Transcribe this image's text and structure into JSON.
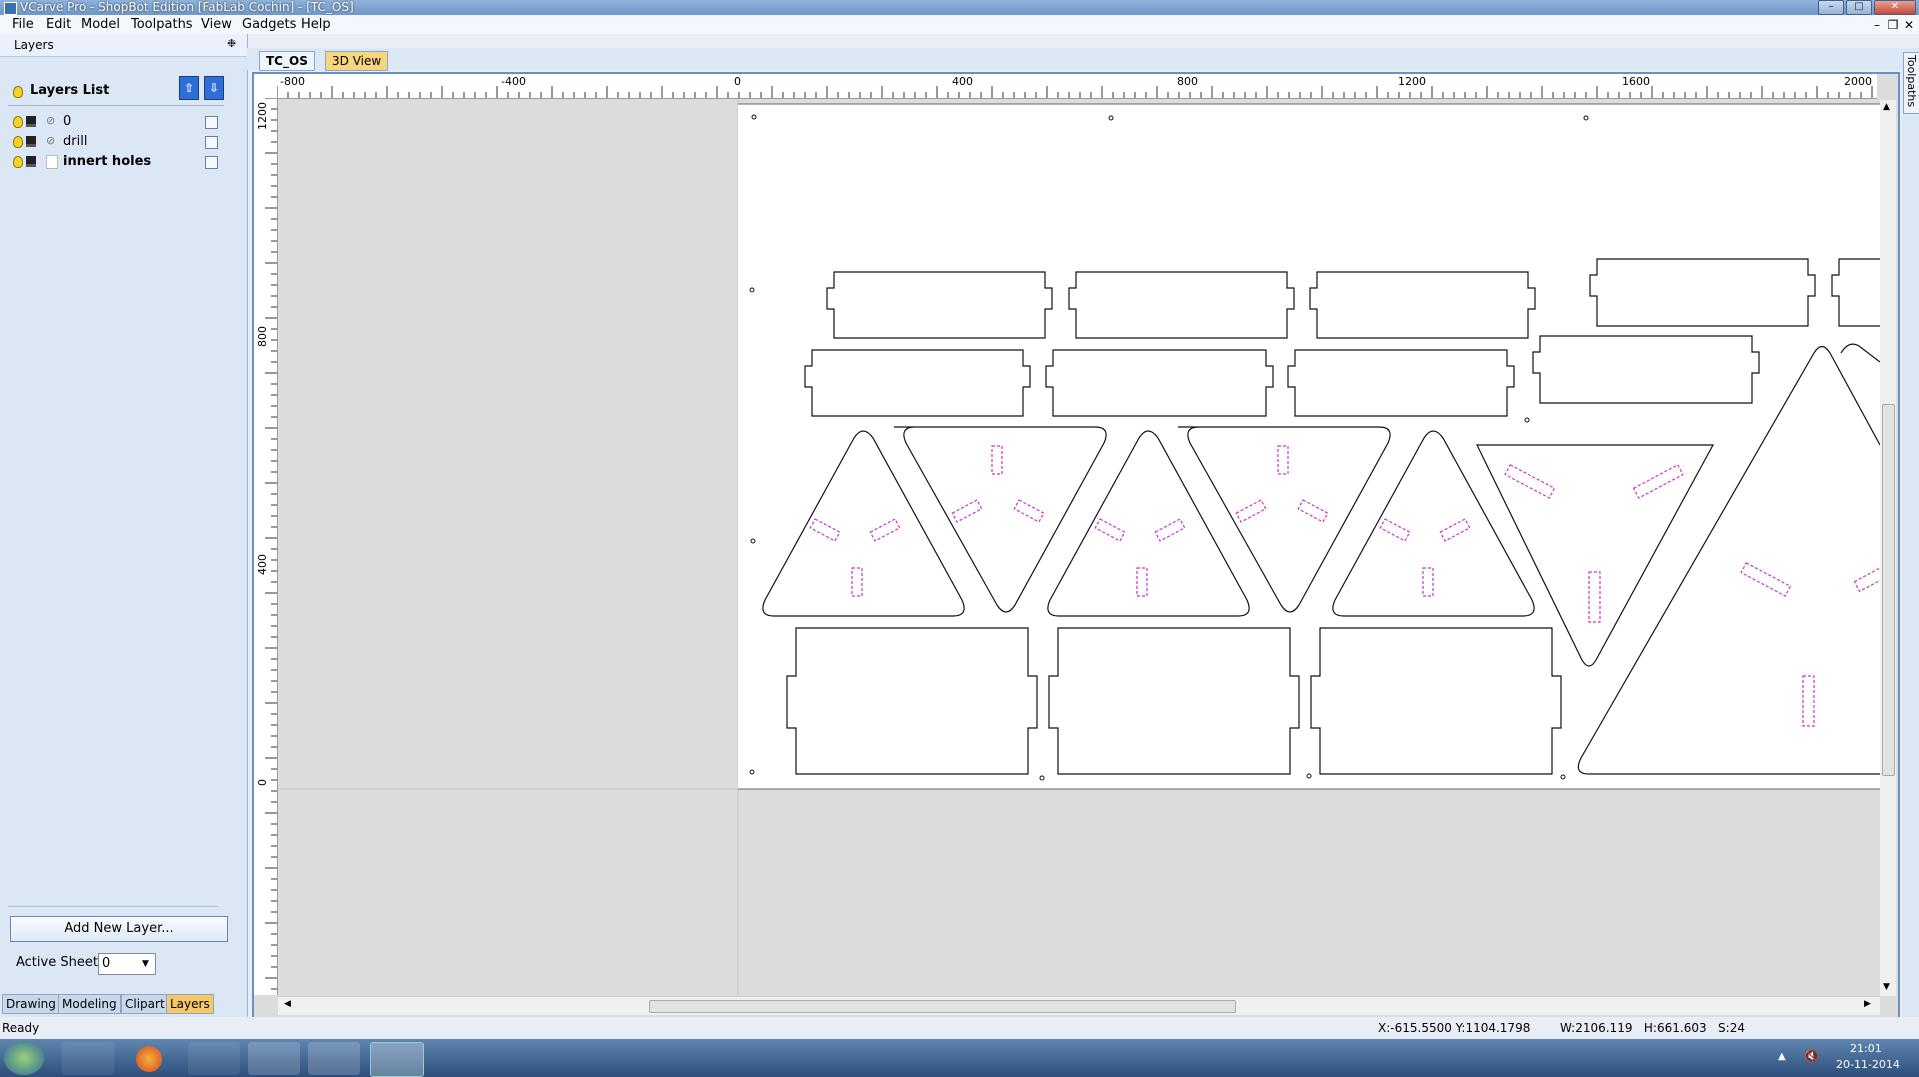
{
  "window": {
    "title": "VCarve Pro - ShopBot Edition [FabLab Cochin] - [TC_OS]",
    "minimize": "–",
    "maximize": "□",
    "close": "✕"
  },
  "menu": [
    "File",
    "Edit",
    "Model",
    "Toolpaths",
    "View",
    "Gadgets",
    "Help"
  ],
  "mdi_controls": {
    "minimize": "–",
    "restore": "❐",
    "close": "✕"
  },
  "layers_panel": {
    "header": "Layers",
    "pin": "❉",
    "list_title": "Layers List",
    "layers": [
      {
        "name": "0",
        "bold": false,
        "checkbox_icon": "tick"
      },
      {
        "name": "drill",
        "bold": false,
        "checkbox_icon": "tick"
      },
      {
        "name": "innert holes",
        "bold": true,
        "checkbox_icon": "none"
      }
    ],
    "add_button": "Add New Layer...",
    "active_sheet_label": "Active Sheet:",
    "active_sheet_value": "0"
  },
  "bottom_tabs": [
    "Drawing",
    "Modeling",
    "Clipart",
    "Layers"
  ],
  "doc_tabs": [
    "TC_OS",
    "3D View"
  ],
  "right_strip_label": "Toolpaths",
  "ruler": {
    "h_labels": [
      "-800",
      "-400",
      "0",
      "400",
      "800",
      "1200",
      "1600",
      "2000"
    ],
    "v_labels": [
      "1200",
      "800",
      "400",
      "0"
    ]
  },
  "status": {
    "left": "Ready",
    "coords": "X:-615.5500 Y:1104.1798",
    "size": "W:2106.119   H:661.603   S:24"
  },
  "taskbar": {
    "time": "21:01",
    "date": "20-11-2014",
    "apps": [
      "windows-start",
      "paint",
      "firefox",
      "vcarve-gadget",
      "explorer",
      "chrome",
      "vcarve-pro"
    ]
  },
  "colors": {
    "outline": "#111111",
    "holes": "#cc33cc",
    "canvas_bg": "#dcdcdc",
    "material": "#ffffff"
  }
}
